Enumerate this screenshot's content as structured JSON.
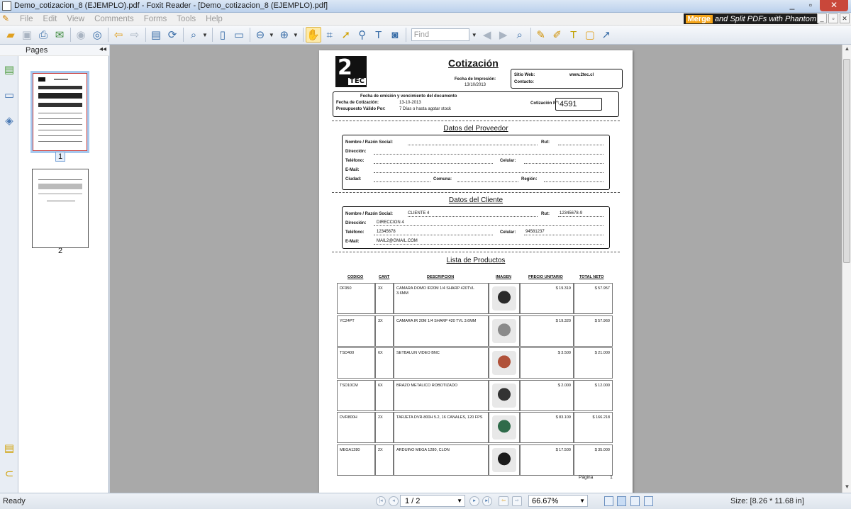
{
  "window": {
    "title": "Demo_cotizacion_8 (EJEMPLO).pdf - Foxit Reader - [Demo_cotizacion_8 (EJEMPLO).pdf]",
    "minimize": "_",
    "maximize": "▫",
    "close": "✕"
  },
  "menu": {
    "items": [
      "File",
      "Edit",
      "View",
      "Comments",
      "Forms",
      "Tools",
      "Help"
    ],
    "promo_merge": "Merge",
    "promo_rest": "and Split PDFs with Phantom"
  },
  "toolbar": {
    "find_placeholder": "Find"
  },
  "pages_panel": {
    "title": "Pages",
    "collapse": "◂◂",
    "thumb1_label": "1",
    "thumb2_label": "2"
  },
  "document": {
    "logo_main": "2",
    "logo_sub": "TEC",
    "title": "Cotización",
    "fecha_impresion_label": "Fecha de Impresión:",
    "fecha_impresion_value": "13/10/2013",
    "sitio_web_label": "Sitio Web:",
    "sitio_web_value": "www.2tec.cl",
    "contacto_label": "Contacto:",
    "emision_header": "Fecha de emisión y vencimiento del documento",
    "fecha_cotizacion_label": "Fecha de Cotización:",
    "fecha_cotizacion_value": "13-10-2013",
    "presupuesto_label": "Presupuesto Válido Por:",
    "presupuesto_value": "7 Días o hasta agotar stock",
    "cotizacion_no_label": "Cotización Nº:",
    "cotizacion_no_value": "4591",
    "proveedor_title": "Datos del Proveedor",
    "proveedor": {
      "nombre": "Nombre / Razón Social:",
      "rut": "Rut:",
      "direccion": "Dirección:",
      "telefono": "Teléfono:",
      "celular": "Celular:",
      "email": "E-Mail:",
      "ciudad": "Ciudad:",
      "comuna": "Comuna:",
      "region": "Región:"
    },
    "cliente_title": "Datos del Cliente",
    "cliente": {
      "nombre_label": "Nombre / Razón Social:",
      "nombre_value": "CLIENTE 4",
      "rut_label": "Rut:",
      "rut_value": "12345678-9",
      "direccion_label": "Dirección:",
      "direccion_value": "DIRECCION 4",
      "telefono_label": "Teléfono:",
      "telefono_value": "12345678",
      "celular_label": "Celular:",
      "celular_value": "94581237",
      "email_label": "E-Mail:",
      "email_value": "MAIL2@GMAIL.COM"
    },
    "productos_title": "Lista de Productos",
    "columns": [
      "CODIGO",
      "CANT",
      "DESCRIPCION",
      "IMAGEN",
      "PRECIO UNITARIO",
      "TOTAL NETO"
    ],
    "rows": [
      {
        "codigo": "DF950",
        "cant": "3X",
        "descripcion": "CAMARA DOMO IR20M 1/4 SHARP 420TVL 3.6MM",
        "precio": "$ 19.319",
        "total": "$ 57.957",
        "img_color": "#2a2a2a"
      },
      {
        "codigo": "YC24PT",
        "cant": "3X",
        "descripcion": "CAMARA IR 20M 1/4 SHARP 420 TVL 3.6MM",
        "precio": "$ 19.320",
        "total": "$ 57.960",
        "img_color": "#8a8a8a"
      },
      {
        "codigo": "TSD400",
        "cant": "6X",
        "descripcion": "SETBALUN VIDEO BNC",
        "precio": "$ 3.500",
        "total": "$ 21.000",
        "img_color": "#b0523a"
      },
      {
        "codigo": "TSD10CM",
        "cant": "6X",
        "descripcion": "BRAZO METALICO ROBOTIZADO",
        "precio": "$ 2.000",
        "total": "$ 12.000",
        "img_color": "#333333"
      },
      {
        "codigo": "DVR800H",
        "cant": "2X",
        "descripcion": "TARJETA DVR-800H 5.2, 16 CANALES, 120 FPS",
        "precio": "$ 83.109",
        "total": "$ 166.218",
        "img_color": "#2f6b4a"
      },
      {
        "codigo": "MEGA1280",
        "cant": "2X",
        "descripcion": "ARDUINO MEGA 1280, CLON",
        "precio": "$ 17.500",
        "total": "$ 35.000",
        "img_color": "#1c1c1c"
      }
    ],
    "footer_label": "Página",
    "footer_num": "1"
  },
  "status": {
    "ready": "Ready",
    "page_indicator": "1 / 2",
    "zoom": "66.67%",
    "size": "Size: [8.26 * 11.68 in]"
  }
}
